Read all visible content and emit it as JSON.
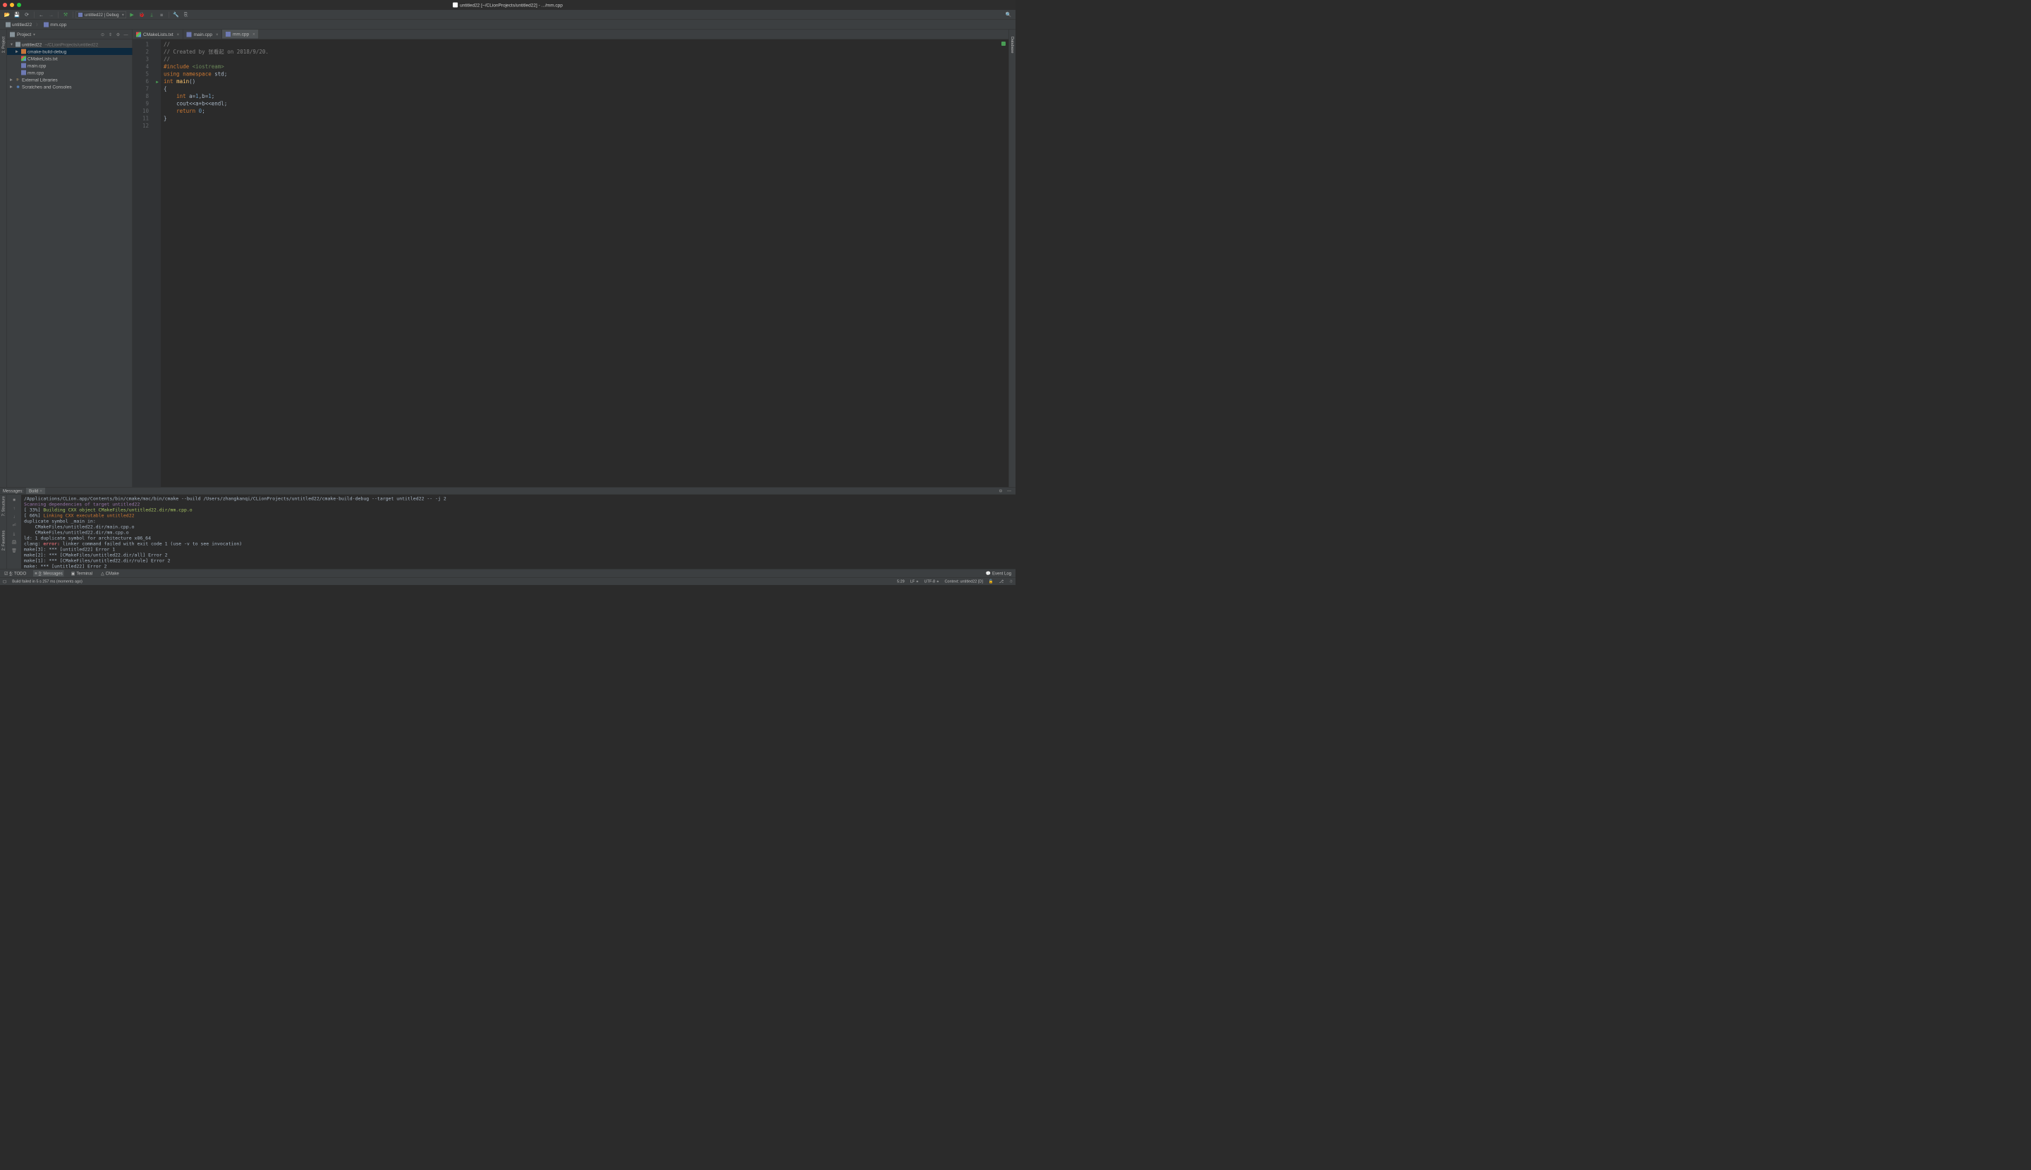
{
  "window": {
    "title": "untitled22 [~/CLionProjects/untitled22] - .../mm.cpp"
  },
  "toolbar": {
    "config": "untitled22 | Debug"
  },
  "breadcrumb": {
    "items": [
      "untitled22",
      "mm.cpp"
    ]
  },
  "project_panel": {
    "title": "Project",
    "root_name": "untitled22",
    "root_path": "~/CLionProjects/untitled22",
    "items": [
      {
        "name": "cmake-build-debug",
        "type": "folder"
      },
      {
        "name": "CMakeLists.txt",
        "type": "cmake"
      },
      {
        "name": "main.cpp",
        "type": "cpp"
      },
      {
        "name": "mm.cpp",
        "type": "cpp"
      }
    ],
    "external_libraries": "External Libraries",
    "scratches": "Scratches and Consoles"
  },
  "editor": {
    "tabs": [
      {
        "name": "CMakeLists.txt",
        "active": false
      },
      {
        "name": "main.cpp",
        "active": false
      },
      {
        "name": "mm.cpp",
        "active": true
      }
    ],
    "code_lines": [
      {
        "n": 1,
        "cls": "c-comment",
        "text": "//"
      },
      {
        "n": 2,
        "cls": "c-comment",
        "text": "// Created by 张看起 on 2018/9/20."
      },
      {
        "n": 3,
        "cls": "c-comment",
        "text": "//"
      },
      {
        "n": 4,
        "html": "<span class='c-keyword'>#include</span> <span class='c-include'>&lt;iostream&gt;</span>"
      },
      {
        "n": 5,
        "html": "<span class='c-keyword'>using</span> <span class='c-keyword'>namespace</span> <span class='c-plain'>std;</span>"
      },
      {
        "n": 6,
        "html": "<span class='c-keyword'>int</span> <span class='c-func'>main</span><span class='c-plain'>()</span>",
        "run": true
      },
      {
        "n": 7,
        "html": "<span class='c-plain'>{</span>"
      },
      {
        "n": 8,
        "html": "    <span class='c-keyword'>int</span> <span class='c-plain'>a=</span><span class='c-num'>1</span><span class='c-plain'>,b=</span><span class='c-num'>1</span><span class='c-plain'>;</span>"
      },
      {
        "n": 9,
        "html": "    <span class='c-plain'>cout&lt;&lt;a+b&lt;&lt;endl;</span>"
      },
      {
        "n": 10,
        "html": "    <span class='c-keyword'>return</span> <span class='c-num'>0</span><span class='c-plain'>;</span>"
      },
      {
        "n": 11,
        "html": "<span class='c-plain'>}</span>"
      },
      {
        "n": 12,
        "html": ""
      }
    ]
  },
  "messages": {
    "title": "Messages:",
    "tab": "Build",
    "lines": [
      {
        "cls": "con-info",
        "text": "/Applications/CLion.app/Contents/bin/cmake/mac/bin/cmake --build /Users/zhangkanqi/CLionProjects/untitled22/cmake-build-debug --target untitled22 -- -j 2"
      },
      {
        "cls": "con-purple",
        "text": "Scanning dependencies of target untitled22"
      },
      {
        "html": "<span class='con-info'>[ 33%] </span><span class='con-green'>Building CXX object CMakeFiles/untitled22.dir/mm.cpp.o</span>"
      },
      {
        "html": "<span class='con-info'>[ 66%] </span><span class='con-yellow'>Linking CXX executable untitled22</span>"
      },
      {
        "cls": "con-info",
        "text": "duplicate symbol _main in:"
      },
      {
        "cls": "con-info",
        "text": "    CMakeFiles/untitled22.dir/main.cpp.o"
      },
      {
        "cls": "con-info",
        "text": "    CMakeFiles/untitled22.dir/mm.cpp.o"
      },
      {
        "cls": "con-info",
        "text": "ld: 1 duplicate symbol for architecture x86_64"
      },
      {
        "html": "<span class='con-info'>clang: </span><span class='con-error'>error:</span><span class='con-info'> linker command failed with exit code 1 (use -v to see invocation)</span>"
      },
      {
        "cls": "con-info",
        "text": "make[3]: *** [untitled22] Error 1"
      },
      {
        "cls": "con-info",
        "text": "make[2]: *** [CMakeFiles/untitled22.dir/all] Error 2"
      },
      {
        "cls": "con-info",
        "text": "make[1]: *** [CMakeFiles/untitled22.dir/rule] Error 2"
      },
      {
        "cls": "con-info",
        "text": "make: *** [untitled22] Error 2"
      }
    ]
  },
  "bottom_tabs": {
    "todo": "6: TODO",
    "messages": "0: Messages",
    "terminal": "Terminal",
    "cmake": "CMake",
    "event_log": "Event Log"
  },
  "status": {
    "message": "Build failed in 5 s 257 ms (moments ago)",
    "cursor": "5:29",
    "line_sep": "LF",
    "encoding": "UTF-8",
    "context": "Context: untitled22 [D]"
  },
  "left_rail": {
    "project": "1: Project",
    "structure": "7: Structure",
    "favorites": "2: Favorites"
  },
  "right_rail": {
    "database": "Database"
  }
}
